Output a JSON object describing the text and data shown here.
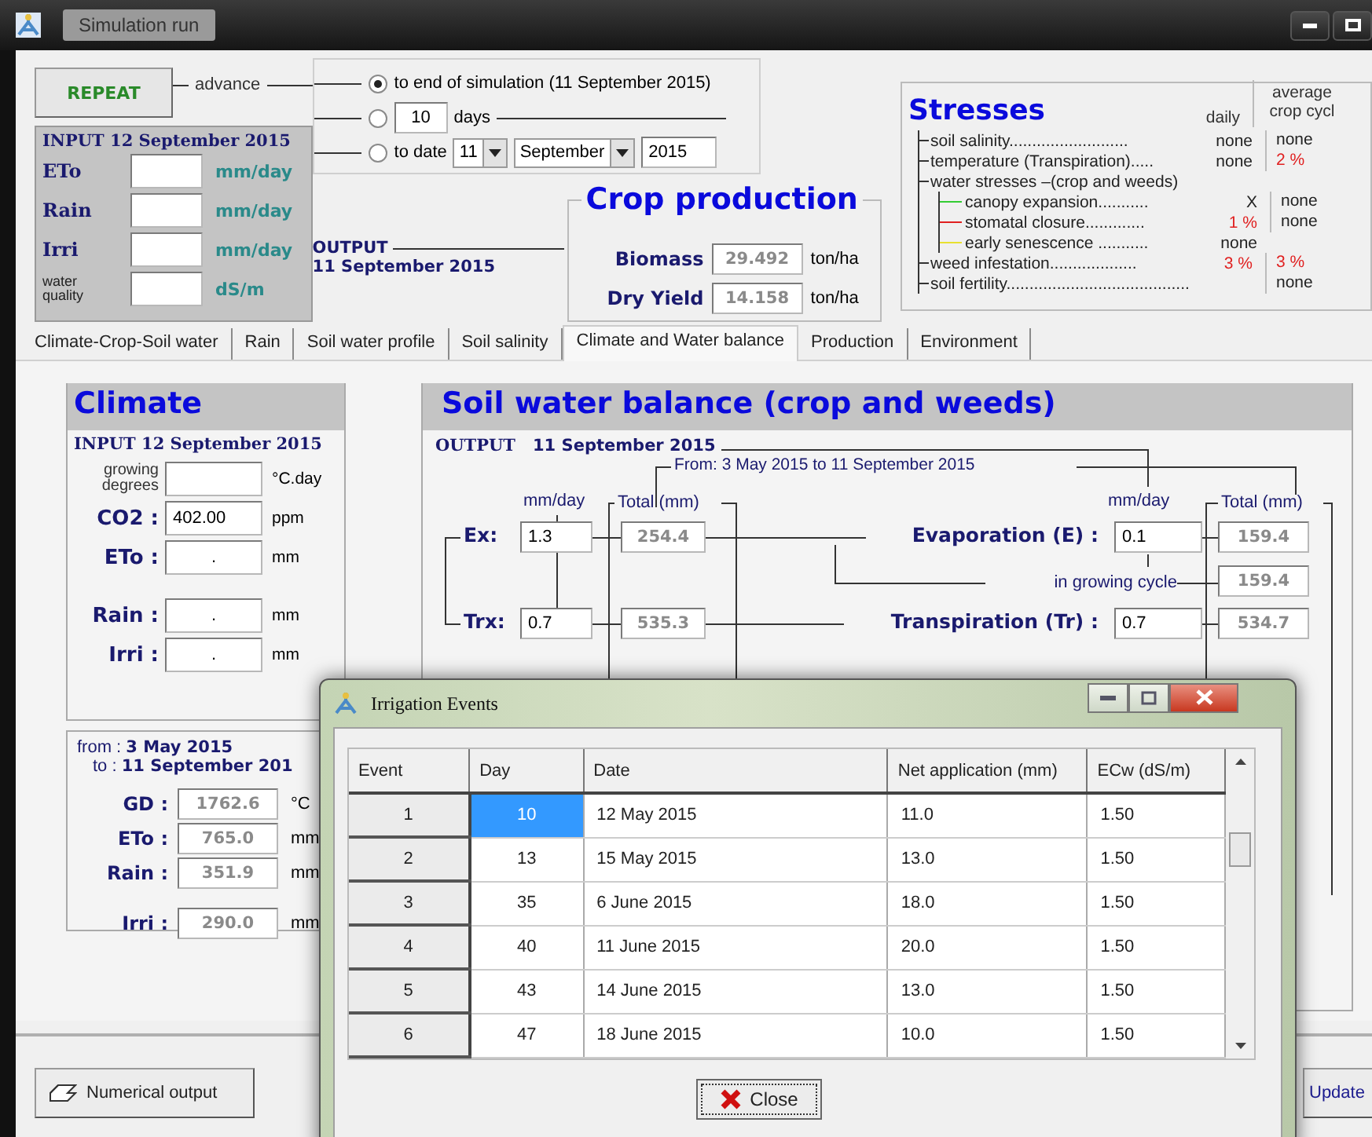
{
  "window": {
    "title": "Simulation run"
  },
  "repeat_button": "REPEAT",
  "advance": {
    "label": "advance",
    "options": [
      {
        "kind": "end",
        "label": "to end of simulation  (11 September 2015)",
        "selected": true
      },
      {
        "kind": "days",
        "value": "10",
        "unit": "days",
        "selected": false
      },
      {
        "kind": "date",
        "label": "to date",
        "day": "11",
        "month": "September",
        "year": "2015",
        "selected": false
      }
    ]
  },
  "input": {
    "title": "INPUT",
    "date": "12 September 2015",
    "rows": [
      {
        "kind": "big",
        "label": "ETo",
        "unit": "mm/day"
      },
      {
        "kind": "big",
        "label": "Rain",
        "unit": "mm/day"
      },
      {
        "kind": "big",
        "label": "Irri",
        "unit": "mm/day"
      },
      {
        "kind": "small",
        "label": "water quality",
        "unit": "dS/m"
      }
    ]
  },
  "output": {
    "label": "OUTPUT",
    "date": "11 September 2015"
  },
  "crop_production": {
    "title": "Crop production",
    "rows": [
      {
        "label": "Biomass",
        "value": "29.492",
        "unit": "ton/ha"
      },
      {
        "label": "Dry Yield",
        "value": "14.158",
        "unit": "ton/ha"
      }
    ]
  },
  "stresses": {
    "title": "Stresses",
    "daily_heading": "daily",
    "average_heading": "average",
    "average_heading_2": "crop cycl",
    "rows": [
      {
        "label": "soil salinity..........................",
        "daily": "none",
        "daily_alert": false,
        "average": "none",
        "average_alert": false
      },
      {
        "label": "temperature (Transpiration).....",
        "daily": "none",
        "daily_alert": false,
        "average": "2 %",
        "average_alert": true
      },
      {
        "label": "water stresses –(crop and weeds)",
        "children": [
          {
            "label": "canopy expansion...........",
            "color": "#33cc33",
            "daily": "X",
            "daily_alert": false,
            "average": "none",
            "average_alert": false
          },
          {
            "label": "stomatal closure.............",
            "color": "#e02020",
            "daily": "1 %",
            "daily_alert": true,
            "average": "none",
            "average_alert": false
          },
          {
            "label": "early senescence ...........",
            "color": "#e8e030",
            "daily": "none",
            "daily_alert": false
          }
        ]
      },
      {
        "label": "weed infestation...................",
        "daily": "3 %",
        "daily_alert": true,
        "average": "3 %",
        "average_alert": true
      },
      {
        "label": "soil fertility........................................",
        "average": "none",
        "average_alert": false
      }
    ]
  },
  "tabs": [
    {
      "label": "Climate-Crop-Soil water",
      "selected": false
    },
    {
      "label": "Rain",
      "selected": false
    },
    {
      "label": "Soil water profile",
      "selected": false
    },
    {
      "label": "Soil salinity",
      "selected": false
    },
    {
      "label": "Climate and Water balance",
      "selected": true
    },
    {
      "label": "Production",
      "selected": false
    },
    {
      "label": "Environment",
      "selected": false
    }
  ],
  "climate": {
    "title": "Climate",
    "input_label": "INPUT",
    "input_date": "12 September 2015",
    "rows": [
      {
        "kind": "small",
        "label": "growing degrees",
        "unit": "°C.day"
      },
      {
        "kind": "big",
        "label": "CO2 :",
        "value": "402.00",
        "unit": "ppm"
      },
      {
        "kind": "big",
        "label": "ETo :",
        "value": ".",
        "unit": "mm"
      },
      {
        "kind": "big",
        "label": "Rain :",
        "value": ".",
        "unit": "mm"
      },
      {
        "kind": "big",
        "label": "Irri :",
        "value": ".",
        "unit": "mm"
      }
    ]
  },
  "period": {
    "from_label": "from :",
    "from": "3 May 2015",
    "to_label": "to :",
    "to": "11 September 201",
    "rows": [
      {
        "label": "GD :",
        "value": "1762.6",
        "unit": "°C"
      },
      {
        "label": "ETo :",
        "value": "765.0",
        "unit": "mm"
      },
      {
        "label": "Rain :",
        "value": "351.9",
        "unit": "mm"
      },
      {
        "label": "Irri :",
        "value": "290.0",
        "unit": "mm"
      }
    ]
  },
  "water_balance": {
    "title": "Soil water balance (crop and weeds)",
    "output_label": "OUTPUT",
    "output_date": "11 September 2015",
    "period": "From: 3 May 2015  to 11 September 2015",
    "left": {
      "unit": "mm/day",
      "total_heading": "Total (mm)",
      "rows": [
        {
          "label": "Ex:",
          "daily": "1.3",
          "total": "254.4"
        },
        {
          "label": "Trx:",
          "daily": "0.7",
          "total": "535.3"
        }
      ]
    },
    "right": {
      "unit": "mm/day",
      "total_heading": "Total (mm)",
      "rows": [
        {
          "kind": "main",
          "label": "Evaporation (E) :",
          "daily": "0.1",
          "total": "159.4"
        },
        {
          "kind": "sub",
          "label": "in growing cycle",
          "total": "159.4"
        },
        {
          "kind": "main",
          "label": "Transpiration (Tr) :",
          "daily": "0.7",
          "total": "534.7"
        }
      ]
    }
  },
  "buttons": {
    "numerical_output": "Numerical output",
    "update": "Update"
  },
  "dialog": {
    "title": "Irrigation Events",
    "columns": [
      "Event",
      "Day",
      "Date",
      "Net application (mm)",
      "ECw (dS/m)"
    ],
    "rows": [
      {
        "cells": [
          "1",
          "10",
          "12 May 2015",
          "11.0",
          "1.50"
        ],
        "selected": true
      },
      {
        "cells": [
          "2",
          "13",
          "15 May 2015",
          "13.0",
          "1.50"
        ],
        "selected": false
      },
      {
        "cells": [
          "3",
          "35",
          "6 June 2015",
          "18.0",
          "1.50"
        ],
        "selected": false
      },
      {
        "cells": [
          "4",
          "40",
          "11 June 2015",
          "20.0",
          "1.50"
        ],
        "selected": false
      },
      {
        "cells": [
          "5",
          "43",
          "14 June 2015",
          "13.0",
          "1.50"
        ],
        "selected": false
      },
      {
        "cells": [
          "6",
          "47",
          "18 June 2015",
          "10.0",
          "1.50"
        ],
        "selected": false
      }
    ],
    "close_button": "Close"
  }
}
